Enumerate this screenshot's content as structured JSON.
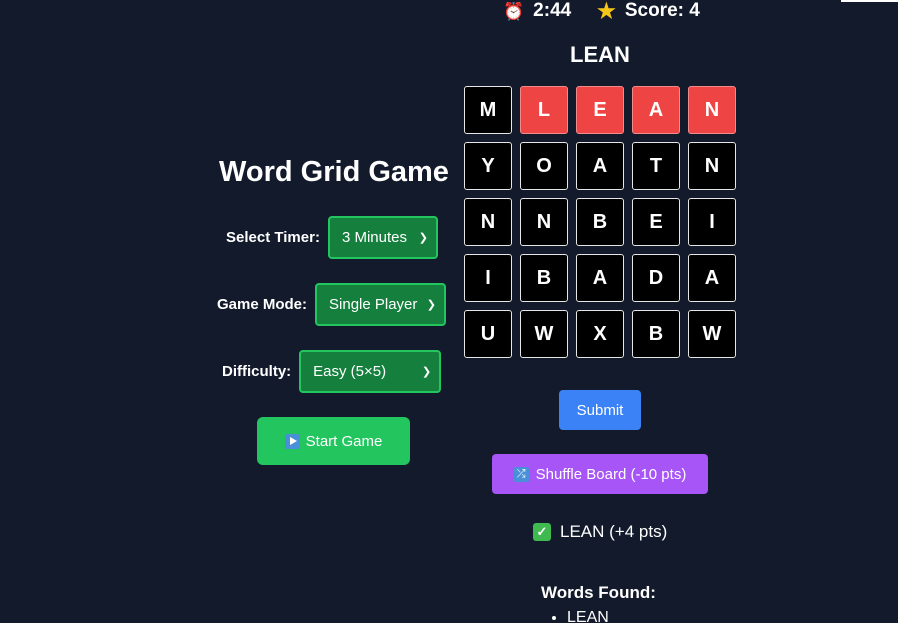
{
  "hud": {
    "timer_icon": "alarm-clock-icon",
    "timer": "2:44",
    "score_icon": "star-icon",
    "score": "Score: 4"
  },
  "current_word": "LEAN",
  "grid": {
    "rows": [
      [
        {
          "letter": "M",
          "selected": false
        },
        {
          "letter": "L",
          "selected": true
        },
        {
          "letter": "E",
          "selected": true
        },
        {
          "letter": "A",
          "selected": true
        },
        {
          "letter": "N",
          "selected": true
        }
      ],
      [
        {
          "letter": "Y",
          "selected": false
        },
        {
          "letter": "O",
          "selected": false
        },
        {
          "letter": "A",
          "selected": false
        },
        {
          "letter": "T",
          "selected": false
        },
        {
          "letter": "N",
          "selected": false
        }
      ],
      [
        {
          "letter": "N",
          "selected": false
        },
        {
          "letter": "N",
          "selected": false
        },
        {
          "letter": "B",
          "selected": false
        },
        {
          "letter": "E",
          "selected": false
        },
        {
          "letter": "I",
          "selected": false
        }
      ],
      [
        {
          "letter": "I",
          "selected": false
        },
        {
          "letter": "B",
          "selected": false
        },
        {
          "letter": "A",
          "selected": false
        },
        {
          "letter": "D",
          "selected": false
        },
        {
          "letter": "A",
          "selected": false
        }
      ],
      [
        {
          "letter": "U",
          "selected": false
        },
        {
          "letter": "W",
          "selected": false
        },
        {
          "letter": "X",
          "selected": false
        },
        {
          "letter": "B",
          "selected": false
        },
        {
          "letter": "W",
          "selected": false
        }
      ]
    ]
  },
  "setup": {
    "title": "Word Grid Game",
    "timer_label": "Select Timer:",
    "timer_value": "3 Minutes",
    "mode_label": "Game Mode:",
    "mode_value": "Single Player",
    "difficulty_label": "Difficulty:",
    "difficulty_value": "Easy (5×5)",
    "start_label": "Start Game"
  },
  "actions": {
    "submit_label": "Submit",
    "shuffle_label": "Shuffle Board (-10 pts)"
  },
  "feedback": "LEAN (+4 pts)",
  "found": {
    "title": "Words Found:",
    "words": [
      "LEAN"
    ]
  },
  "colors": {
    "background": "#121a2b",
    "selected_cell": "#ef4444",
    "select_green": "#15803d",
    "start_green": "#22c55e",
    "submit_blue": "#3b82f6",
    "shuffle_purple": "#a855f7"
  }
}
